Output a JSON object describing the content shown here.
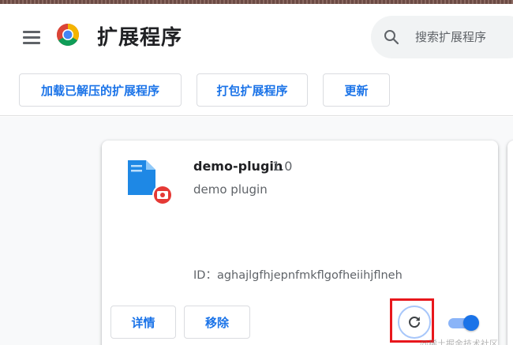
{
  "colors": {
    "accent": "#1a73e8",
    "highlight": "#e8171c",
    "toggle_on": "#1a73e8"
  },
  "header": {
    "title": "扩展程序",
    "menu_icon": "hamburger-menu-icon",
    "logo": "chrome-logo-icon",
    "search": {
      "placeholder": "搜索扩展程序",
      "value": "",
      "icon": "search-icon"
    }
  },
  "toolbar": {
    "load_unpacked_label": "加载已解压的扩展程序",
    "pack_label": "打包扩展程序",
    "update_label": "更新"
  },
  "extension": {
    "name": "demo-plugin",
    "version": "1.0",
    "description": "demo plugin",
    "id_text": "ID：aghajlgfhjepnfmkflgofheiihjflneh",
    "icon": "extension-file-icon",
    "details_label": "详情",
    "remove_label": "移除",
    "reload_icon": "reload-icon",
    "enabled": true
  },
  "watermark": "@稀土掘金技术社区"
}
